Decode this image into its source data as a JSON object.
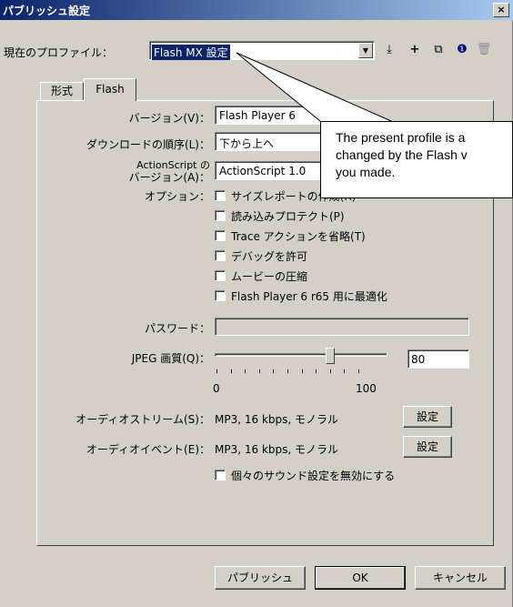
{
  "window": {
    "title": "パブリッシュ設定",
    "close": "×"
  },
  "profile": {
    "label": "現在のプロファイル：",
    "value": "Flash MX 設定"
  },
  "toolbar": {
    "import_export": "⤓",
    "add": "+",
    "duplicate": "⧉",
    "info": "❶",
    "delete": "🗑"
  },
  "tabs": [
    {
      "label": "形式"
    },
    {
      "label": "Flash"
    }
  ],
  "fields": {
    "version_label": "バージョン(V)：",
    "version_value": "Flash Player 6",
    "load_order_label": "ダウンロードの順序(L)：",
    "load_order_value": "下から上へ",
    "as_label_1": "ActionScript の",
    "as_label_2": "バージョン(A)：",
    "as_value": "ActionScript 1.0",
    "options_label": "オプション：",
    "options": [
      "サイズレポートの作成(R)",
      "読み込みプロテクト(P)",
      "Trace アクションを省略(T)",
      "デバッグを許可",
      "ムービーの圧縮",
      "Flash Player 6 r65 用に最適化"
    ],
    "password_label": "パスワード：",
    "jpeg_label": "JPEG 画質(Q)：",
    "jpeg_value": "80",
    "jpeg_quality": 80,
    "slider_min": "0",
    "slider_max": "100",
    "audio_stream_label": "オーディオストリーム(S)：",
    "audio_stream_value": "MP3, 16 kbps, モノラル",
    "audio_event_label": "オーディオイベント(E)：",
    "audio_event_value": "MP3, 16 kbps, モノラル",
    "set_button": "設定",
    "override_sounds": "個々のサウンド設定を無効にする"
  },
  "buttons": {
    "publish": "パブリッシュ",
    "ok": "OK",
    "cancel": "キャンセル"
  },
  "callout": {
    "line1": "The present profile is a",
    "line2": "changed by the Flash v",
    "line3": "you made."
  }
}
